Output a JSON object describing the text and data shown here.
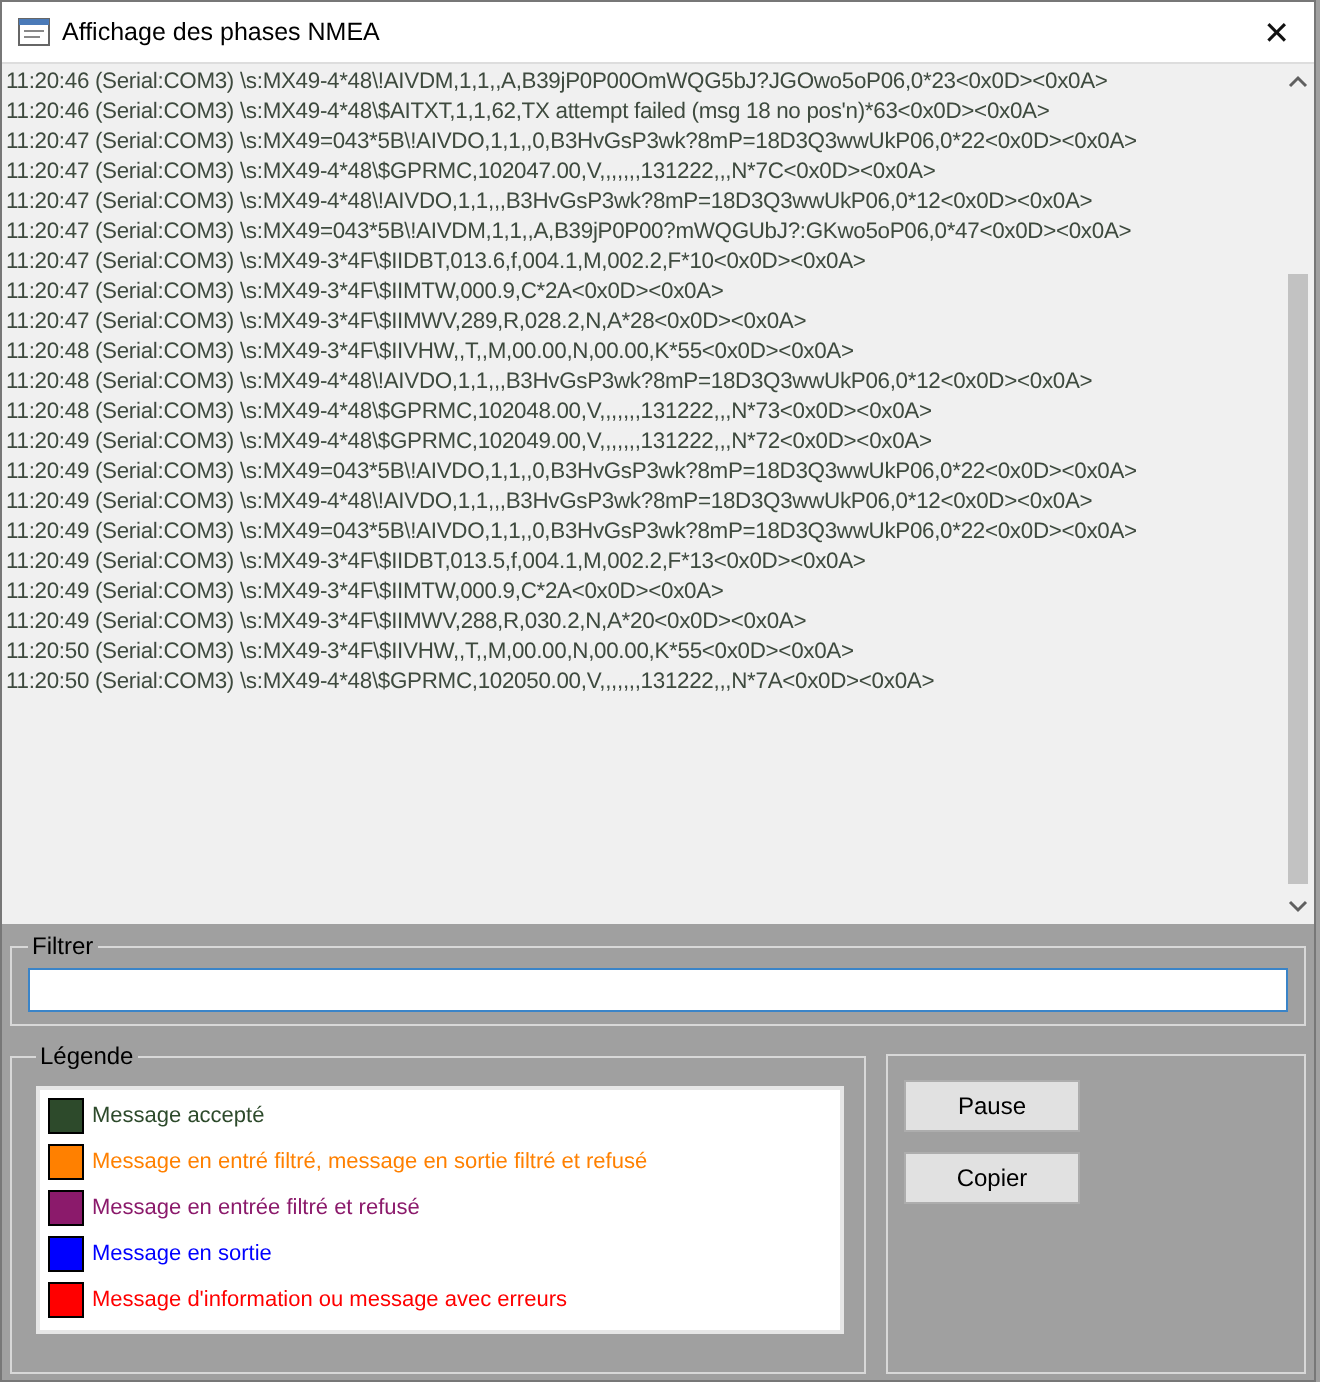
{
  "window": {
    "title": "Affichage des phases NMEA",
    "close": "✕"
  },
  "log": [
    "11:20:46 (Serial:COM3) \\s:MX49-4*48\\!AIVDM,1,1,,A,B39jP0P00OmWQG5bJ?JGOwo5oP06,0*23<0x0D><0x0A>",
    "11:20:46 (Serial:COM3) \\s:MX49-4*48\\$AITXT,1,1,62,TX attempt failed (msg 18 no pos'n)*63<0x0D><0x0A>",
    "11:20:47 (Serial:COM3) \\s:MX49=043*5B\\!AIVDO,1,1,,0,B3HvGsP3wk?8mP=18D3Q3wwUkP06,0*22<0x0D><0x0A>",
    "11:20:47 (Serial:COM3) \\s:MX49-4*48\\$GPRMC,102047.00,V,,,,,,,131222,,,N*7C<0x0D><0x0A>",
    "11:20:47 (Serial:COM3) \\s:MX49-4*48\\!AIVDO,1,1,,,B3HvGsP3wk?8mP=18D3Q3wwUkP06,0*12<0x0D><0x0A>",
    "11:20:47 (Serial:COM3) \\s:MX49=043*5B\\!AIVDM,1,1,,A,B39jP0P00?mWQGUbJ?:GKwo5oP06,0*47<0x0D><0x0A>",
    "11:20:47 (Serial:COM3) \\s:MX49-3*4F\\$IIDBT,013.6,f,004.1,M,002.2,F*10<0x0D><0x0A>",
    "11:20:47 (Serial:COM3) \\s:MX49-3*4F\\$IIMTW,000.9,C*2A<0x0D><0x0A>",
    "11:20:47 (Serial:COM3) \\s:MX49-3*4F\\$IIMWV,289,R,028.2,N,A*28<0x0D><0x0A>",
    "11:20:48 (Serial:COM3) \\s:MX49-3*4F\\$IIVHW,,T,,M,00.00,N,00.00,K*55<0x0D><0x0A>",
    "11:20:48 (Serial:COM3) \\s:MX49-4*48\\!AIVDO,1,1,,,B3HvGsP3wk?8mP=18D3Q3wwUkP06,0*12<0x0D><0x0A>",
    "11:20:48 (Serial:COM3) \\s:MX49-4*48\\$GPRMC,102048.00,V,,,,,,,131222,,,N*73<0x0D><0x0A>",
    "11:20:49 (Serial:COM3) \\s:MX49-4*48\\$GPRMC,102049.00,V,,,,,,,131222,,,N*72<0x0D><0x0A>",
    "11:20:49 (Serial:COM3) \\s:MX49=043*5B\\!AIVDO,1,1,,0,B3HvGsP3wk?8mP=18D3Q3wwUkP06,0*22<0x0D><0x0A>",
    "11:20:49 (Serial:COM3) \\s:MX49-4*48\\!AIVDO,1,1,,,B3HvGsP3wk?8mP=18D3Q3wwUkP06,0*12<0x0D><0x0A>",
    "11:20:49 (Serial:COM3) \\s:MX49=043*5B\\!AIVDO,1,1,,0,B3HvGsP3wk?8mP=18D3Q3wwUkP06,0*22<0x0D><0x0A>",
    "11:20:49 (Serial:COM3) \\s:MX49-3*4F\\$IIDBT,013.5,f,004.1,M,002.2,F*13<0x0D><0x0A>",
    "11:20:49 (Serial:COM3) \\s:MX49-3*4F\\$IIMTW,000.9,C*2A<0x0D><0x0A>",
    "11:20:49 (Serial:COM3) \\s:MX49-3*4F\\$IIMWV,288,R,030.2,N,A*20<0x0D><0x0A>",
    "11:20:50 (Serial:COM3) \\s:MX49-3*4F\\$IIVHW,,T,,M,00.00,N,00.00,K*55<0x0D><0x0A>",
    "11:20:50 (Serial:COM3) \\s:MX49-4*48\\$GPRMC,102050.00,V,,,,,,,131222,,,N*7A<0x0D><0x0A>"
  ],
  "filter": {
    "title": "Filtrer"
  },
  "legend": {
    "title": "Légende",
    "items": [
      {
        "label": "Message accepté",
        "color": "#2d4a2b"
      },
      {
        "label": "Message en entré filtré, message en sortie filtré et refusé",
        "color": "#ff8000"
      },
      {
        "label": "Message en entrée filtré et refusé",
        "color": "#8b1a6b"
      },
      {
        "label": "Message en sortie",
        "color": "#0000ff"
      },
      {
        "label": "Message d'information ou message avec erreurs",
        "color": "#ff0000"
      }
    ]
  },
  "buttons": [
    "Pause",
    "Copier"
  ]
}
